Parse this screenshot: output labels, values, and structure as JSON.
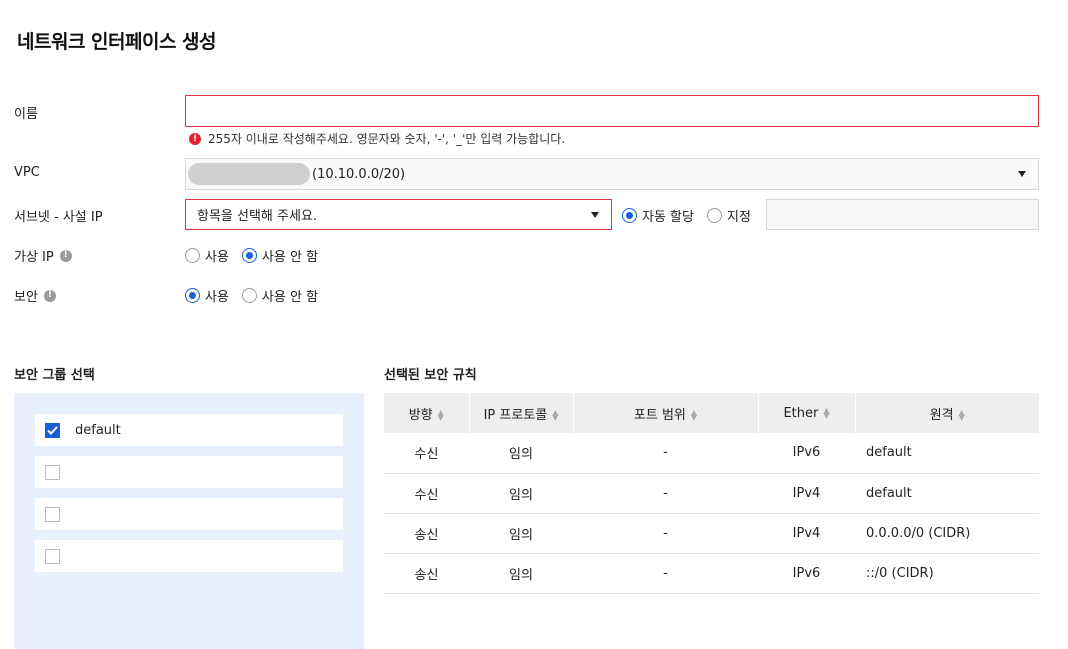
{
  "page": {
    "title": "네트워크 인터페이스 생성"
  },
  "form": {
    "name": {
      "label": "이름",
      "value": "",
      "error": "255자 이내로 작성해주세요. 영문자와 숫자, '-', '_'만 입력 가능합니다."
    },
    "vpc": {
      "label": "VPC",
      "value_suffix": "(10.10.0.0/20)"
    },
    "subnet": {
      "label": "서브넷 - 사설 IP",
      "placeholder": "항목을 선택해 주세요.",
      "ip_options": [
        {
          "label": "자동 할당",
          "checked": true
        },
        {
          "label": "지정",
          "checked": false
        }
      ],
      "ip_value": ""
    },
    "virtual_ip": {
      "label": "가상 IP",
      "options": [
        {
          "label": "사용",
          "checked": false
        },
        {
          "label": "사용 안 함",
          "checked": true
        }
      ]
    },
    "security": {
      "label": "보안",
      "options": [
        {
          "label": "사용",
          "checked": true
        },
        {
          "label": "사용 안 함",
          "checked": false
        }
      ]
    }
  },
  "security_groups": {
    "title": "보안 그룹 선택",
    "items": [
      {
        "label": "default",
        "checked": true
      },
      {
        "label": "",
        "checked": false
      },
      {
        "label": "",
        "checked": false
      },
      {
        "label": "",
        "checked": false
      }
    ]
  },
  "rules": {
    "title": "선택된 보안 규칙",
    "columns": [
      "방향",
      "IP 프로토콜",
      "포트 범위",
      "Ether",
      "원격"
    ],
    "rows": [
      [
        "수신",
        "임의",
        "-",
        "IPv6",
        "default"
      ],
      [
        "수신",
        "임의",
        "-",
        "IPv4",
        "default"
      ],
      [
        "송신",
        "임의",
        "-",
        "IPv4",
        "0.0.0.0/0 (CIDR)"
      ],
      [
        "송신",
        "임의",
        "-",
        "IPv6",
        "::/0 (CIDR)"
      ]
    ]
  },
  "icons": {
    "error": "error-icon",
    "info": "info-icon",
    "sort": "sort-icon",
    "dropdown": "chevron-down-icon",
    "check": "check-icon"
  },
  "colors": {
    "accent": "#1a5fd6",
    "error": "#d9333f",
    "panel": "#e9f0fd"
  }
}
